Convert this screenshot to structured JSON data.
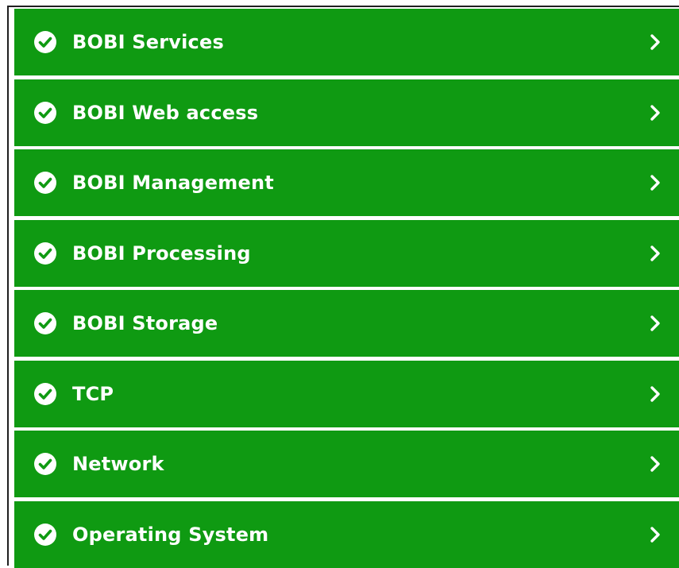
{
  "colors": {
    "row_background": "#0f9a12",
    "text": "#ffffff",
    "icon": "#ffffff",
    "frame_border": "#1f1f1f"
  },
  "status_list": {
    "items": [
      {
        "label": "BOBI Services",
        "status_icon": "check-circle-icon",
        "action_icon": "chevron-right-icon"
      },
      {
        "label": "BOBI Web access",
        "status_icon": "check-circle-icon",
        "action_icon": "chevron-right-icon"
      },
      {
        "label": "BOBI Management",
        "status_icon": "check-circle-icon",
        "action_icon": "chevron-right-icon"
      },
      {
        "label": "BOBI Processing",
        "status_icon": "check-circle-icon",
        "action_icon": "chevron-right-icon"
      },
      {
        "label": "BOBI Storage",
        "status_icon": "check-circle-icon",
        "action_icon": "chevron-right-icon"
      },
      {
        "label": "TCP",
        "status_icon": "check-circle-icon",
        "action_icon": "chevron-right-icon"
      },
      {
        "label": "Network",
        "status_icon": "check-circle-icon",
        "action_icon": "chevron-right-icon"
      },
      {
        "label": "Operating System",
        "status_icon": "check-circle-icon",
        "action_icon": "chevron-right-icon"
      }
    ]
  }
}
